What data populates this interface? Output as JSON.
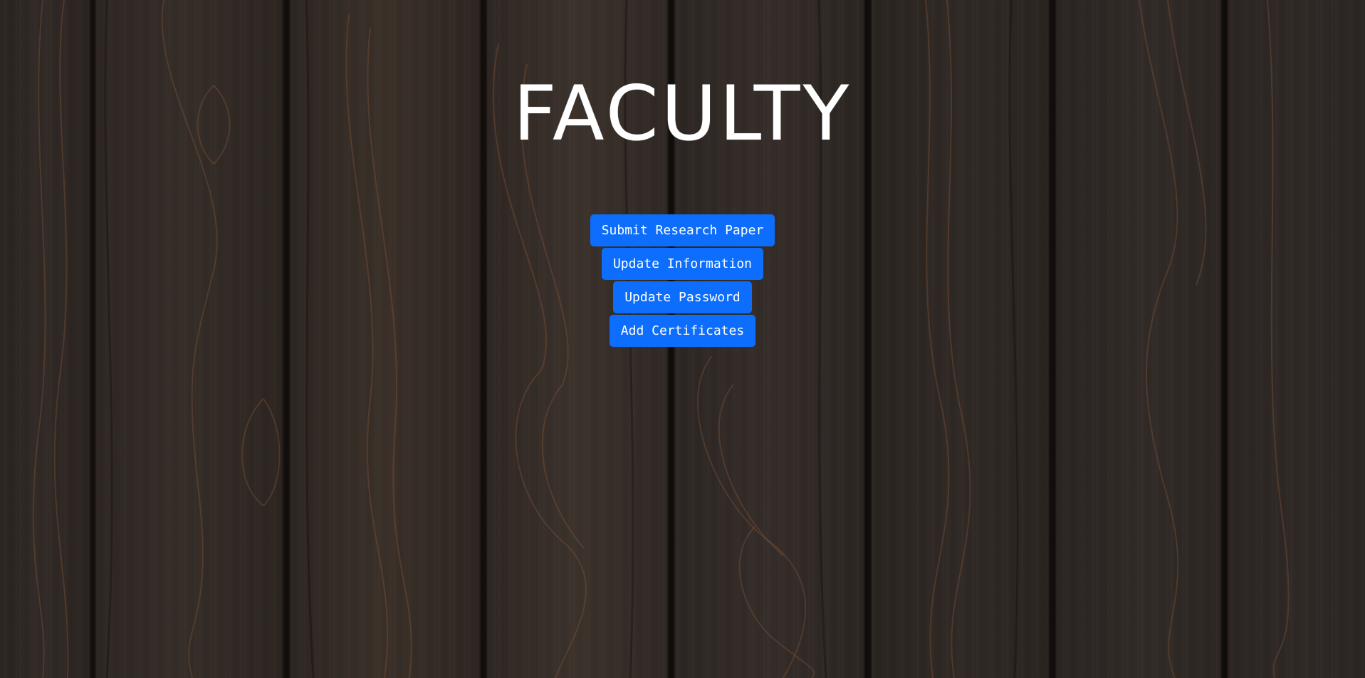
{
  "page": {
    "title": "FACULTY"
  },
  "actions": [
    {
      "label": "Submit Research Paper"
    },
    {
      "label": "Update Information"
    },
    {
      "label": "Update Password"
    },
    {
      "label": "Add Certificates"
    }
  ],
  "colors": {
    "button_bg": "#0d6efd",
    "button_text": "#ffffff",
    "title_text": "#ffffff",
    "background": "#2b2624"
  }
}
